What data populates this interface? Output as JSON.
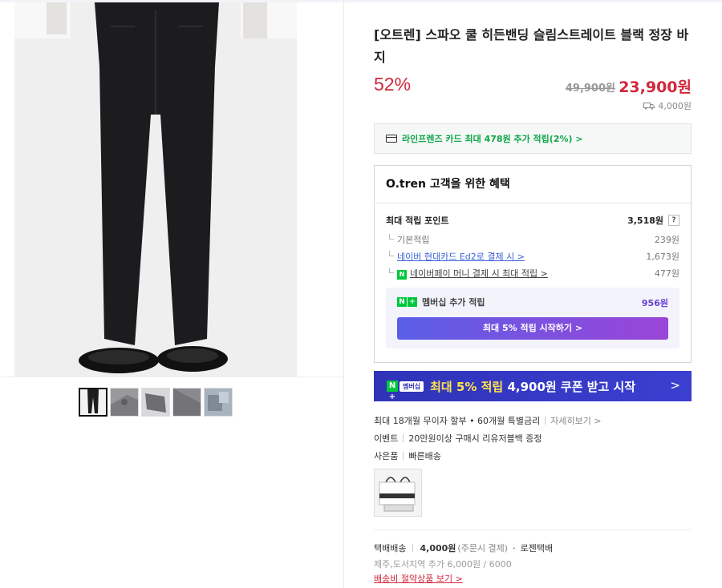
{
  "product": {
    "title": "[오트렌] 스파오 쿨 히든밴딩 슬림스트레이트 블랙 정장 바지",
    "discount": "52%",
    "original_price": "49,900원",
    "sale_price": "23,900원",
    "shipping_fee": "4,000원"
  },
  "card_promo": "라인프렌즈 카드 최대 478원 추가 적립(2%) >",
  "benefit": {
    "title": "O.tren 고객을 위한 혜택",
    "max_points_label": "최대 적립 포인트",
    "max_points_value": "3,518원",
    "help_label": "?",
    "basic_label": "기본적립",
    "basic_value": "239원",
    "card_label": "네이버 현대카드 Ed2로 결제 시 >",
    "card_value": "1,673원",
    "npay_label": "네이버페이 머니 결제 시 최대 적립 >",
    "npay_value": "477원",
    "np_icon": "N",
    "membership": {
      "label": "멤버십 추가 적립",
      "value": "956원",
      "badge_n": "N",
      "badge_plus": "+",
      "button": "최대 5% 적립 시작하기 >"
    }
  },
  "banner": {
    "badge_n": "N +",
    "badge_member": "멤버십",
    "text_hl": "최대 5% 적립",
    "text_rest": " 4,900원 쿠폰 받고 시작",
    "chevron": ">"
  },
  "meta": {
    "installment": "최대 18개월 무이자 할부 • 60개월 특별금리",
    "detail_link": "자세히보기 >",
    "event_label": "이벤트",
    "event_value": "20만원이상 구매시 리유저블백 증정",
    "gift_label": "사은품",
    "fast_label": "빠른배송"
  },
  "shipping": {
    "type": "택배배송",
    "fee": "4,000원",
    "fee_note": "(주문시 결제)",
    "dot": "·",
    "carrier": "로젠택배",
    "extra": "제주,도서지역 추가 6,000원 / 6000",
    "saving_link": "배송비 절약상품 보기 >"
  },
  "colors": {
    "accent_red": "#d1283d",
    "naver_green": "#00c73c",
    "banner_blue": "#2f33b8"
  }
}
